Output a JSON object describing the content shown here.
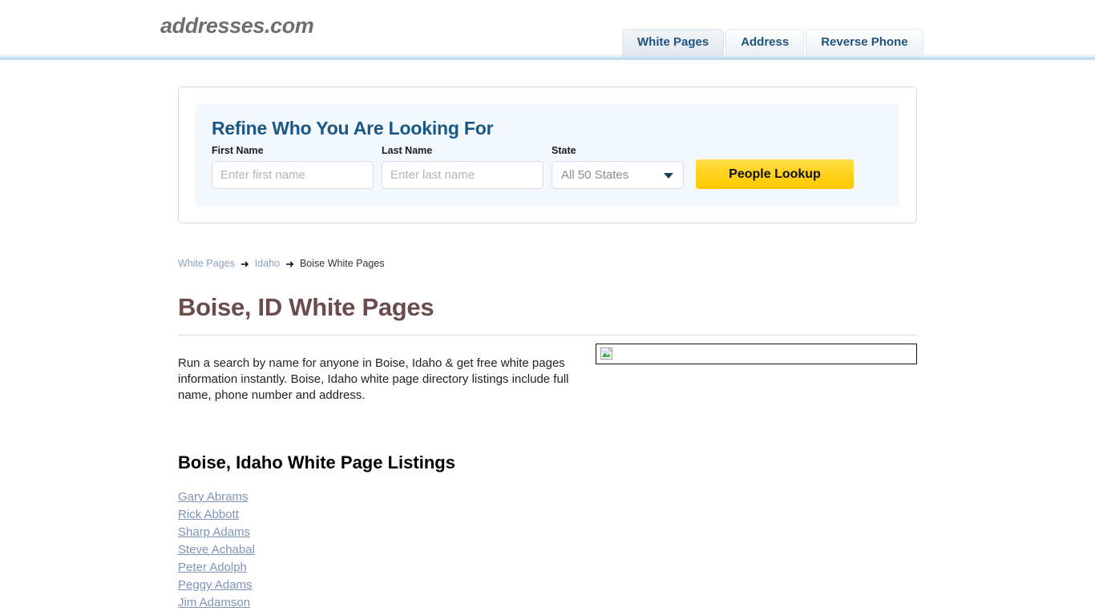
{
  "header": {
    "logo": "addresses.com",
    "tabs": [
      {
        "label": "White Pages",
        "active": true
      },
      {
        "label": "Address",
        "active": false
      },
      {
        "label": "Reverse Phone",
        "active": false
      }
    ]
  },
  "search_panel": {
    "title": "Refine Who You Are Looking For",
    "first_name": {
      "label": "First Name",
      "placeholder": "Enter first name",
      "value": ""
    },
    "last_name": {
      "label": "Last Name",
      "placeholder": "Enter last name",
      "value": ""
    },
    "state": {
      "label": "State",
      "selected": "All 50 States"
    },
    "submit_label": "People Lookup"
  },
  "breadcrumb": {
    "items": [
      {
        "label": "White Pages",
        "link": true
      },
      {
        "label": "Idaho",
        "link": true
      },
      {
        "label": "Boise White Pages",
        "link": false
      }
    ],
    "separator": "➜"
  },
  "main": {
    "page_title": "Boise, ID White Pages",
    "description": "Run a search by name for anyone in Boise, Idaho & get free white pages information instantly. Boise, Idaho white page directory listings include full name, phone number and address.",
    "listings_title": "Boise, Idaho White Page Listings",
    "listings": [
      "Gary Abrams",
      "Rick Abbott",
      "Sharp Adams",
      "Steve Achabal",
      "Peter Adolph",
      "Peggy Adams",
      "Jim Adamson"
    ]
  },
  "colors": {
    "tab_text": "#1f5280",
    "panel_title": "#1a5785",
    "page_title": "#6b4c4c",
    "button": "#ffd21f",
    "link": "#7f94b8"
  }
}
